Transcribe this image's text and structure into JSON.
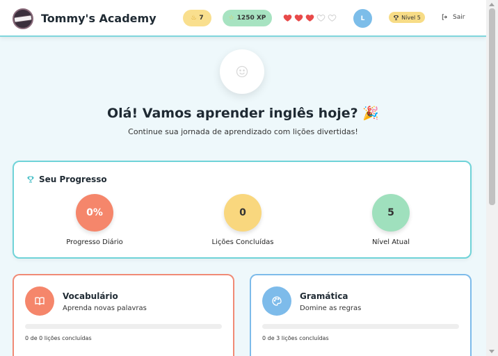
{
  "header": {
    "brand": "Tommy's Academy",
    "streak": "7",
    "xp": "1250 XP",
    "hearts": {
      "filled": 3,
      "total": 5
    },
    "avatar_initial": "L",
    "level_badge": "Nível 5",
    "logout_label": "Sair"
  },
  "hero": {
    "greeting": "Olá! Vamos aprender inglês hoje? 🎉",
    "subtitle": "Continue sua jornada de aprendizado com lições divertidas!"
  },
  "progress": {
    "title": "Seu Progresso",
    "stats": [
      {
        "value": "0%",
        "label": "Progresso Diário",
        "color": "#f5866b"
      },
      {
        "value": "0",
        "label": "Lições Concluídas",
        "color": "#f9d77e"
      },
      {
        "value": "5",
        "label": "Nível Atual",
        "color": "#9fe0bd"
      }
    ]
  },
  "lessons": [
    {
      "name": "Vocabulário",
      "description": "Aprenda novas palavras",
      "progress_text": "0 de 0 lições concluídas",
      "progress_fraction": 0,
      "icon": "book-icon",
      "color": "#f08a75"
    },
    {
      "name": "Gramática",
      "description": "Domine as regras",
      "progress_text": "0 de 3 lições concluídas",
      "progress_fraction": 0,
      "icon": "palette-icon",
      "color": "#7dbbea"
    }
  ],
  "colors": {
    "accent": "#6fd3d8",
    "heart": "#e84a4a",
    "background": "#eef8fb"
  }
}
